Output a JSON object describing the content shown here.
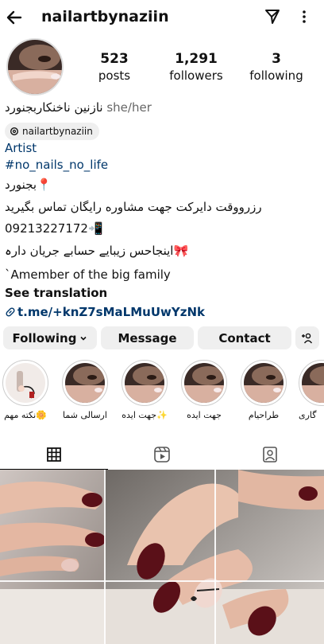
{
  "header": {
    "username": "nailartbynaziin"
  },
  "stats": [
    {
      "value": "523",
      "label": "posts"
    },
    {
      "value": "1,291",
      "label": "followers"
    },
    {
      "value": "3",
      "label": "following"
    }
  ],
  "bio": {
    "name_line": "نازنین ناخنکاربجنورد",
    "pronouns": "she/her",
    "threads_handle": "nailartbynaziin",
    "category": "Artist",
    "hashtag": "#no_nails_no_life",
    "location": "بجنورد📍",
    "reservation": "رزرووقت دایرکت جهت مشاوره رایگان تماس بگیرید",
    "phone": "09213227172📲",
    "telegram_note": "اینجاحس زیبایے حسابے جریان دارہ🎀",
    "family_line": "`Amember of the big family",
    "see_translation": "See translation",
    "link": "t.me/+knZ7sMaLMuUwYzNk"
  },
  "buttons": {
    "following": "Following",
    "message": "Message",
    "contact": "Contact"
  },
  "highlights": [
    {
      "caption": "نکته مهم🌼"
    },
    {
      "caption": "ارسالی شما"
    },
    {
      "caption": "جهت ایده✨"
    },
    {
      "caption": "جهت ایده"
    },
    {
      "caption": "طراحیام"
    },
    {
      "caption": "گاری"
    }
  ],
  "colors": {
    "link_blue": "#00376b",
    "button_bg": "#efefef",
    "nail_burgundy": "#5a1018",
    "skin": "#e9c3ae"
  },
  "icons": {
    "back": "arrow-left-icon",
    "send": "paper-plane-icon",
    "more": "more-vertical-icon",
    "threads": "threads-icon",
    "link": "link-icon",
    "add_person": "add-person-icon",
    "grid_tab": "grid-icon",
    "reels_tab": "reels-icon",
    "tagged_tab": "tagged-icon"
  }
}
